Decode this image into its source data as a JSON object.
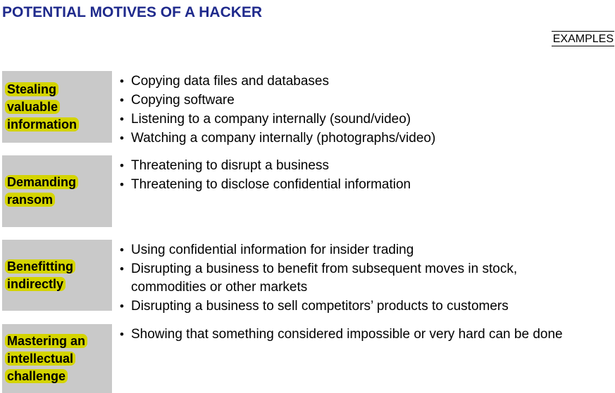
{
  "title": "POTENTIAL MOTIVES OF A HACKER",
  "examples_header": "EXAMPLES",
  "bullet_glyph": "•",
  "colors": {
    "title": "#1f2a8c",
    "motive_box": "#c9c9c9",
    "highlight": "#d4d400"
  },
  "motives": [
    {
      "label_lines": [
        "Stealing",
        "valuable",
        "information"
      ],
      "examples": [
        "Copying data files and databases",
        "Copying software",
        "Listening to a company internally (sound/video)",
        "Watching a company internally (photographs/video)"
      ]
    },
    {
      "label_lines": [
        "Demanding",
        "ransom"
      ],
      "examples": [
        "Threatening to disrupt a business",
        "Threatening to disclose confidential information"
      ]
    },
    {
      "label_lines": [
        "Benefitting",
        "indirectly"
      ],
      "examples": [
        "Using confidential information for insider trading",
        "Disrupting a business to benefit from subsequent moves in stock, commodities or other markets",
        "Disrupting a business to sell competitors’ products to customers"
      ]
    },
    {
      "label_lines": [
        "Mastering an",
        "intellectual",
        "challenge"
      ],
      "examples": [
        "Showing that something considered impossible or very hard can be done"
      ]
    }
  ]
}
